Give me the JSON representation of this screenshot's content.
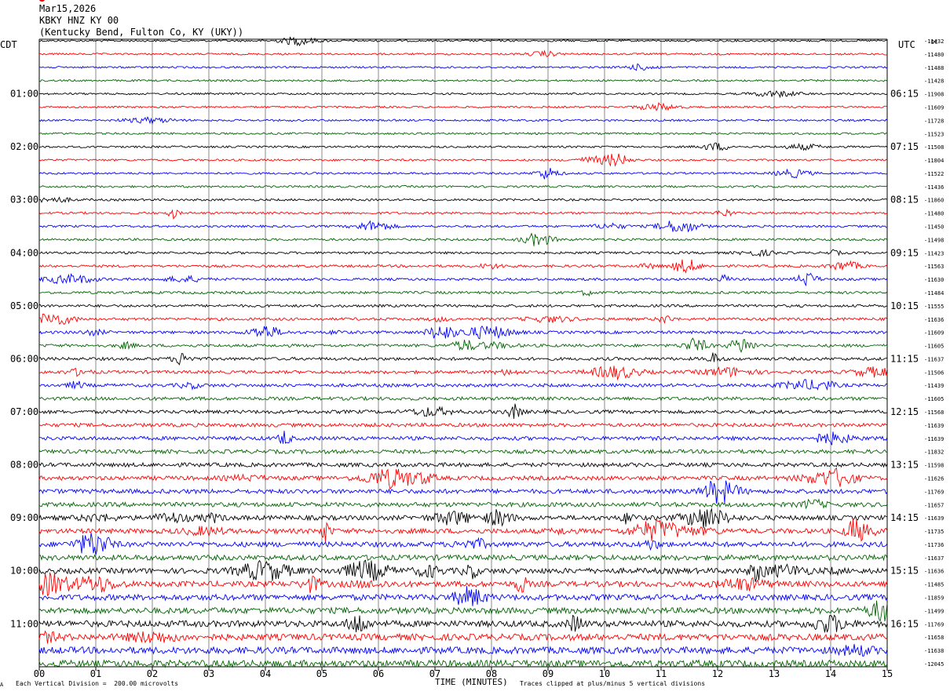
{
  "header": {
    "date": "Mar15,2026",
    "station": "KBKY HNZ KY 00",
    "location": "(Kentucky Bend, Fulton Co, KY (UKY))"
  },
  "left_timezone": "CDT",
  "right_timezone": "UTC",
  "dc_label": "DC",
  "footer": {
    "scale_note": "Each Vertical Division =  200.00 microvolts",
    "xlabel": "TIME (MINUTES)",
    "clip_note": "Traces clipped at plus/minus 5 vertical divisions",
    "corner_mark": "A"
  },
  "chart_data": {
    "type": "line",
    "title": "Mar15,2026 KBKY HNZ KY 00 (Kentucky Bend, Fulton Co, KY (UKY))",
    "xlabel": "TIME (MINUTES)",
    "xlim": [
      0,
      15
    ],
    "x_ticks": [
      "00",
      "01",
      "02",
      "03",
      "04",
      "05",
      "06",
      "07",
      "08",
      "09",
      "10",
      "11",
      "12",
      "13",
      "14",
      "15"
    ],
    "vertical_division_microvolts": 200.0,
    "trace_minutes": 15,
    "trace_count": 48,
    "trace_colors": [
      "#000000",
      "#ff0000",
      "#0000ff",
      "#006400"
    ],
    "left_hour_labels": [
      "01:00",
      "02:00",
      "03:00",
      "04:00",
      "05:00",
      "06:00",
      "07:00",
      "08:00",
      "09:00",
      "10:00",
      "11:00"
    ],
    "right_hour_labels": [
      "06:15",
      "07:15",
      "08:15",
      "09:15",
      "10:15",
      "11:15",
      "12:15",
      "13:15",
      "14:15",
      "15:15",
      "16:15"
    ],
    "dc_offsets": [
      "-11432",
      "-11480",
      "-11488",
      "-11428",
      "-11908",
      "-11609",
      "-11728",
      "-11523",
      "-11508",
      "-11804",
      "-11522",
      "-11436",
      "-11860",
      "-11480",
      "-11450",
      "-11498",
      "-11423",
      "-11563",
      "-11630",
      "-11484",
      "-11555",
      "-11636",
      "-11609",
      "-11605",
      "-11637",
      "-11506",
      "-11439",
      "-11605",
      "-11568",
      "-11639",
      "-11639",
      "-11832",
      "-11598",
      "-11626",
      "-11769",
      "-11657",
      "-11639",
      "-11735",
      "-11736",
      "-11637",
      "-11636",
      "-11485",
      "-11859",
      "-11499",
      "-11769",
      "-11658",
      "-11638",
      "-12045"
    ]
  }
}
